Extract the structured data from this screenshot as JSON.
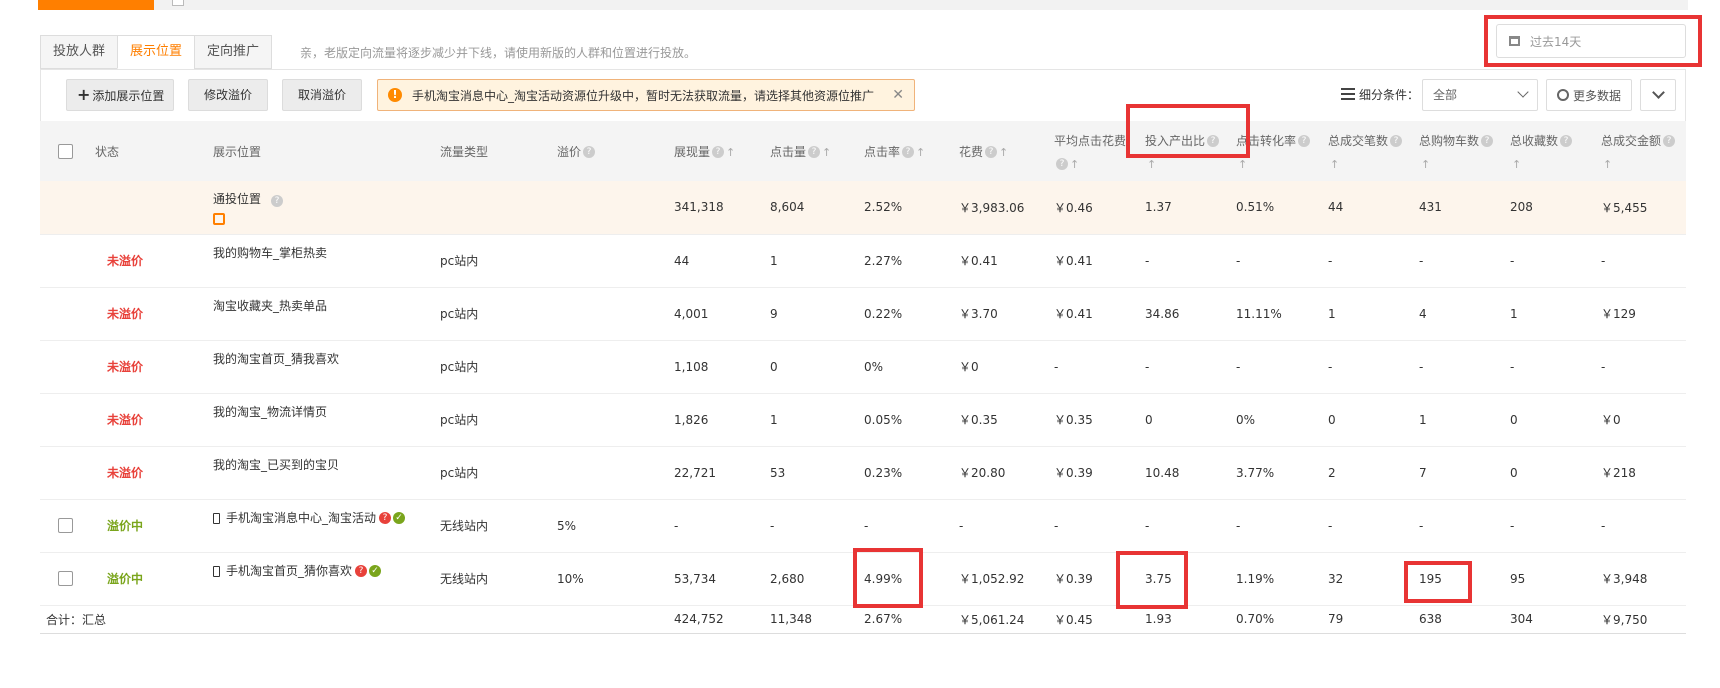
{
  "tabs": [
    {
      "label": "投放人群"
    },
    {
      "label": "展示位置"
    },
    {
      "label": "定向推广"
    }
  ],
  "notice": "亲，老版定向流量将逐步减少并下线，请使用新版的人群和位置进行投放。",
  "date_range": "过去14天",
  "toolbar": {
    "add_label": "添加展示位置",
    "modify_label": "修改溢价",
    "cancel_label": "取消溢价",
    "alert_text": "手机淘宝消息中心_淘宝活动资源位升级中，暂时无法获取流量，请选择其他资源位推广",
    "filter_label": "细分条件：",
    "filter_value": "全部",
    "more_label": "更多数据"
  },
  "headers": {
    "status": "状态",
    "place": "展示位置",
    "flow": "流量类型",
    "premium": "溢价",
    "impressions": "展现量",
    "clicks": "点击量",
    "ctr": "点击率",
    "cost": "花费",
    "cpc": "平均点击花费",
    "roi": "投入产出比",
    "cvr": "点击转化率",
    "orders": "总成交笔数",
    "carts": "总购物车数",
    "favorites": "总收藏数",
    "revenue": "总成交金额"
  },
  "rows": [
    {
      "status": "",
      "place": "通投位置",
      "flow": "",
      "premium": "",
      "impressions": "341,318",
      "clicks": "8,604",
      "ctr": "2.52%",
      "cost": "￥3,983.06",
      "cpc": "￥0.46",
      "roi": "1.37",
      "cvr": "0.51%",
      "orders": "44",
      "carts": "431",
      "favorites": "208",
      "revenue": "￥5,455"
    },
    {
      "status": "未溢价",
      "place": "我的购物车_掌柜热卖",
      "flow": "pc站内",
      "premium": "",
      "impressions": "44",
      "clicks": "1",
      "ctr": "2.27%",
      "cost": "￥0.41",
      "cpc": "￥0.41",
      "roi": "-",
      "cvr": "-",
      "orders": "-",
      "carts": "-",
      "favorites": "-",
      "revenue": "-"
    },
    {
      "status": "未溢价",
      "place": "淘宝收藏夹_热卖单品",
      "flow": "pc站内",
      "premium": "",
      "impressions": "4,001",
      "clicks": "9",
      "ctr": "0.22%",
      "cost": "￥3.70",
      "cpc": "￥0.41",
      "roi": "34.86",
      "cvr": "11.11%",
      "orders": "1",
      "carts": "4",
      "favorites": "1",
      "revenue": "￥129"
    },
    {
      "status": "未溢价",
      "place": "我的淘宝首页_猜我喜欢",
      "flow": "pc站内",
      "premium": "",
      "impressions": "1,108",
      "clicks": "0",
      "ctr": "0%",
      "cost": "￥0",
      "cpc": "-",
      "roi": "-",
      "cvr": "-",
      "orders": "-",
      "carts": "-",
      "favorites": "-",
      "revenue": "-"
    },
    {
      "status": "未溢价",
      "place": "我的淘宝_物流详情页",
      "flow": "pc站内",
      "premium": "",
      "impressions": "1,826",
      "clicks": "1",
      "ctr": "0.05%",
      "cost": "￥0.35",
      "cpc": "￥0.35",
      "roi": "0",
      "cvr": "0%",
      "orders": "0",
      "carts": "1",
      "favorites": "0",
      "revenue": "￥0"
    },
    {
      "status": "未溢价",
      "place": "我的淘宝_已买到的宝贝",
      "flow": "pc站内",
      "premium": "",
      "impressions": "22,721",
      "clicks": "53",
      "ctr": "0.23%",
      "cost": "￥20.80",
      "cpc": "￥0.39",
      "roi": "10.48",
      "cvr": "3.77%",
      "orders": "2",
      "carts": "7",
      "favorites": "0",
      "revenue": "￥218"
    },
    {
      "status": "溢价中",
      "place": "手机淘宝消息中心_淘宝活动",
      "flow": "无线站内",
      "premium": "5%",
      "impressions": "-",
      "clicks": "-",
      "ctr": "-",
      "cost": "-",
      "cpc": "-",
      "roi": "-",
      "cvr": "-",
      "orders": "-",
      "carts": "-",
      "favorites": "-",
      "revenue": "-"
    },
    {
      "status": "溢价中",
      "place": "手机淘宝首页_猜你喜欢",
      "flow": "无线站内",
      "premium": "10%",
      "impressions": "53,734",
      "clicks": "2,680",
      "ctr": "4.99%",
      "cost": "￥1,052.92",
      "cpc": "￥0.39",
      "roi": "3.75",
      "cvr": "1.19%",
      "orders": "32",
      "carts": "195",
      "favorites": "95",
      "revenue": "￥3,948"
    }
  ],
  "total": {
    "label": "合计：汇总",
    "impressions": "424,752",
    "clicks": "11,348",
    "ctr": "2.67%",
    "cost": "￥5,061.24",
    "cpc": "￥0.45",
    "roi": "1.93",
    "cvr": "0.70%",
    "orders": "79",
    "carts": "638",
    "favorites": "304",
    "revenue": "￥9,750"
  },
  "colors": {
    "accent": "#ff7f00",
    "status_red": "#e8413a",
    "status_green": "#7aa51c",
    "annotation": "#e83434"
  }
}
